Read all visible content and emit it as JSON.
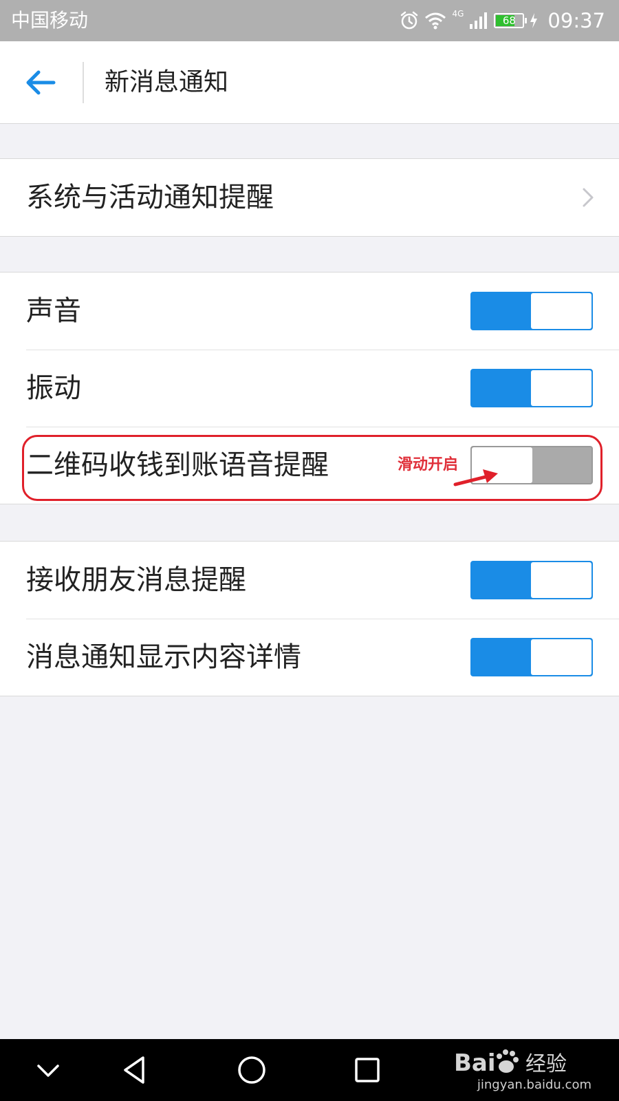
{
  "status_bar": {
    "carrier": "中国移动",
    "network_label": "4G",
    "battery_level": "68",
    "time": "09:37",
    "icons": [
      "alarm-icon",
      "wifi-icon",
      "signal-icon",
      "battery-icon",
      "charging-icon"
    ]
  },
  "header": {
    "back_icon": "arrow-left-icon",
    "title": "新消息通知"
  },
  "groups": [
    {
      "rows": [
        {
          "label": "系统与活动通知提醒",
          "control": "chevron-right-icon"
        }
      ]
    },
    {
      "rows": [
        {
          "label": "声音",
          "toggle": "on"
        },
        {
          "label": "振动",
          "toggle": "on"
        },
        {
          "label": "二维码收钱到账语音提醒",
          "toggle": "off"
        }
      ]
    },
    {
      "rows": [
        {
          "label": "接收朋友消息提醒",
          "toggle": "on"
        },
        {
          "label": "消息通知显示内容详情",
          "toggle": "on"
        }
      ]
    }
  ],
  "annotation": {
    "text": "滑动开启",
    "color": "#e0202a"
  },
  "nav_bar": {
    "buttons": [
      "collapse-icon",
      "back-triangle-icon",
      "home-circle-icon",
      "recents-square-icon"
    ]
  },
  "watermark": {
    "logo_text": "Bai百 经验",
    "url": "jingyan.baidu.com"
  },
  "colors": {
    "accent": "#1a8ce6",
    "toggle_off": "#aaaaaa",
    "background": "#f2f2f6",
    "status_bar": "#b0b0b0"
  }
}
